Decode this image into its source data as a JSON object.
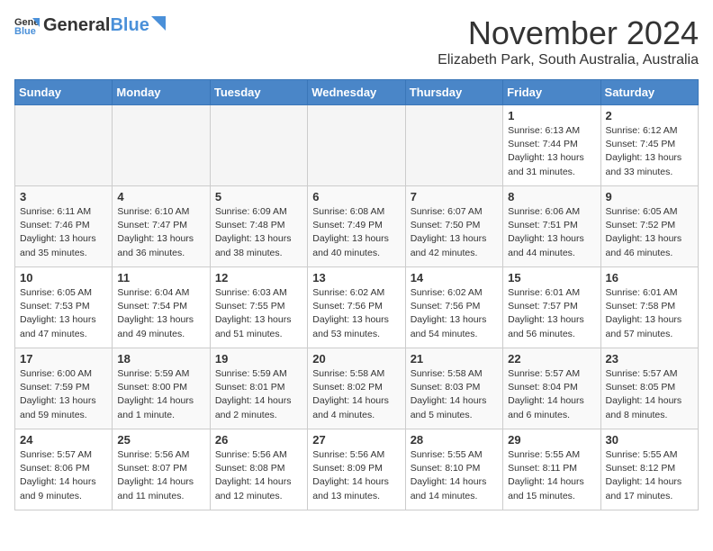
{
  "header": {
    "logo_general": "General",
    "logo_blue": "Blue",
    "month": "November 2024",
    "location": "Elizabeth Park, South Australia, Australia"
  },
  "weekdays": [
    "Sunday",
    "Monday",
    "Tuesday",
    "Wednesday",
    "Thursday",
    "Friday",
    "Saturday"
  ],
  "weeks": [
    [
      {
        "day": "",
        "info": ""
      },
      {
        "day": "",
        "info": ""
      },
      {
        "day": "",
        "info": ""
      },
      {
        "day": "",
        "info": ""
      },
      {
        "day": "",
        "info": ""
      },
      {
        "day": "1",
        "info": "Sunrise: 6:13 AM\nSunset: 7:44 PM\nDaylight: 13 hours\nand 31 minutes."
      },
      {
        "day": "2",
        "info": "Sunrise: 6:12 AM\nSunset: 7:45 PM\nDaylight: 13 hours\nand 33 minutes."
      }
    ],
    [
      {
        "day": "3",
        "info": "Sunrise: 6:11 AM\nSunset: 7:46 PM\nDaylight: 13 hours\nand 35 minutes."
      },
      {
        "day": "4",
        "info": "Sunrise: 6:10 AM\nSunset: 7:47 PM\nDaylight: 13 hours\nand 36 minutes."
      },
      {
        "day": "5",
        "info": "Sunrise: 6:09 AM\nSunset: 7:48 PM\nDaylight: 13 hours\nand 38 minutes."
      },
      {
        "day": "6",
        "info": "Sunrise: 6:08 AM\nSunset: 7:49 PM\nDaylight: 13 hours\nand 40 minutes."
      },
      {
        "day": "7",
        "info": "Sunrise: 6:07 AM\nSunset: 7:50 PM\nDaylight: 13 hours\nand 42 minutes."
      },
      {
        "day": "8",
        "info": "Sunrise: 6:06 AM\nSunset: 7:51 PM\nDaylight: 13 hours\nand 44 minutes."
      },
      {
        "day": "9",
        "info": "Sunrise: 6:05 AM\nSunset: 7:52 PM\nDaylight: 13 hours\nand 46 minutes."
      }
    ],
    [
      {
        "day": "10",
        "info": "Sunrise: 6:05 AM\nSunset: 7:53 PM\nDaylight: 13 hours\nand 47 minutes."
      },
      {
        "day": "11",
        "info": "Sunrise: 6:04 AM\nSunset: 7:54 PM\nDaylight: 13 hours\nand 49 minutes."
      },
      {
        "day": "12",
        "info": "Sunrise: 6:03 AM\nSunset: 7:55 PM\nDaylight: 13 hours\nand 51 minutes."
      },
      {
        "day": "13",
        "info": "Sunrise: 6:02 AM\nSunset: 7:56 PM\nDaylight: 13 hours\nand 53 minutes."
      },
      {
        "day": "14",
        "info": "Sunrise: 6:02 AM\nSunset: 7:56 PM\nDaylight: 13 hours\nand 54 minutes."
      },
      {
        "day": "15",
        "info": "Sunrise: 6:01 AM\nSunset: 7:57 PM\nDaylight: 13 hours\nand 56 minutes."
      },
      {
        "day": "16",
        "info": "Sunrise: 6:01 AM\nSunset: 7:58 PM\nDaylight: 13 hours\nand 57 minutes."
      }
    ],
    [
      {
        "day": "17",
        "info": "Sunrise: 6:00 AM\nSunset: 7:59 PM\nDaylight: 13 hours\nand 59 minutes."
      },
      {
        "day": "18",
        "info": "Sunrise: 5:59 AM\nSunset: 8:00 PM\nDaylight: 14 hours\nand 1 minute."
      },
      {
        "day": "19",
        "info": "Sunrise: 5:59 AM\nSunset: 8:01 PM\nDaylight: 14 hours\nand 2 minutes."
      },
      {
        "day": "20",
        "info": "Sunrise: 5:58 AM\nSunset: 8:02 PM\nDaylight: 14 hours\nand 4 minutes."
      },
      {
        "day": "21",
        "info": "Sunrise: 5:58 AM\nSunset: 8:03 PM\nDaylight: 14 hours\nand 5 minutes."
      },
      {
        "day": "22",
        "info": "Sunrise: 5:57 AM\nSunset: 8:04 PM\nDaylight: 14 hours\nand 6 minutes."
      },
      {
        "day": "23",
        "info": "Sunrise: 5:57 AM\nSunset: 8:05 PM\nDaylight: 14 hours\nand 8 minutes."
      }
    ],
    [
      {
        "day": "24",
        "info": "Sunrise: 5:57 AM\nSunset: 8:06 PM\nDaylight: 14 hours\nand 9 minutes."
      },
      {
        "day": "25",
        "info": "Sunrise: 5:56 AM\nSunset: 8:07 PM\nDaylight: 14 hours\nand 11 minutes."
      },
      {
        "day": "26",
        "info": "Sunrise: 5:56 AM\nSunset: 8:08 PM\nDaylight: 14 hours\nand 12 minutes."
      },
      {
        "day": "27",
        "info": "Sunrise: 5:56 AM\nSunset: 8:09 PM\nDaylight: 14 hours\nand 13 minutes."
      },
      {
        "day": "28",
        "info": "Sunrise: 5:55 AM\nSunset: 8:10 PM\nDaylight: 14 hours\nand 14 minutes."
      },
      {
        "day": "29",
        "info": "Sunrise: 5:55 AM\nSunset: 8:11 PM\nDaylight: 14 hours\nand 15 minutes."
      },
      {
        "day": "30",
        "info": "Sunrise: 5:55 AM\nSunset: 8:12 PM\nDaylight: 14 hours\nand 17 minutes."
      }
    ]
  ]
}
